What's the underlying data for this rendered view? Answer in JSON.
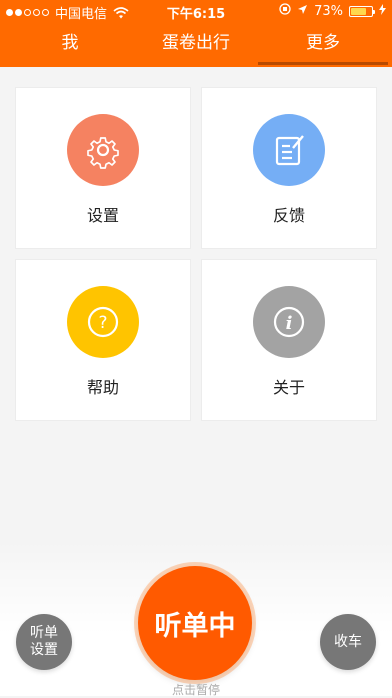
{
  "status_bar": {
    "carrier": "中国电信",
    "time": "下午6:15",
    "battery": "73%",
    "battery_level": 0.73
  },
  "tabs": [
    {
      "label": "我"
    },
    {
      "label": "蛋卷出行"
    },
    {
      "label": "更多",
      "selected": true
    }
  ],
  "menu": [
    {
      "label": "设置",
      "icon": "gear-icon",
      "color": "#f58261"
    },
    {
      "label": "反馈",
      "icon": "feedback-icon",
      "color": "#75aef5"
    },
    {
      "label": "帮助",
      "icon": "help-icon",
      "color": "#ffc400"
    },
    {
      "label": "关于",
      "icon": "info-icon",
      "color": "#a3a3a3"
    }
  ],
  "bottom": {
    "settings_label_line1": "听单",
    "settings_label_line2": "设置",
    "main_label": "听单中",
    "pause_hint": "点击暂停",
    "stop_label": "收车"
  },
  "colors": {
    "brand": "#ff6a00",
    "main_button": "#ff5a00",
    "side_button": "#777777"
  }
}
